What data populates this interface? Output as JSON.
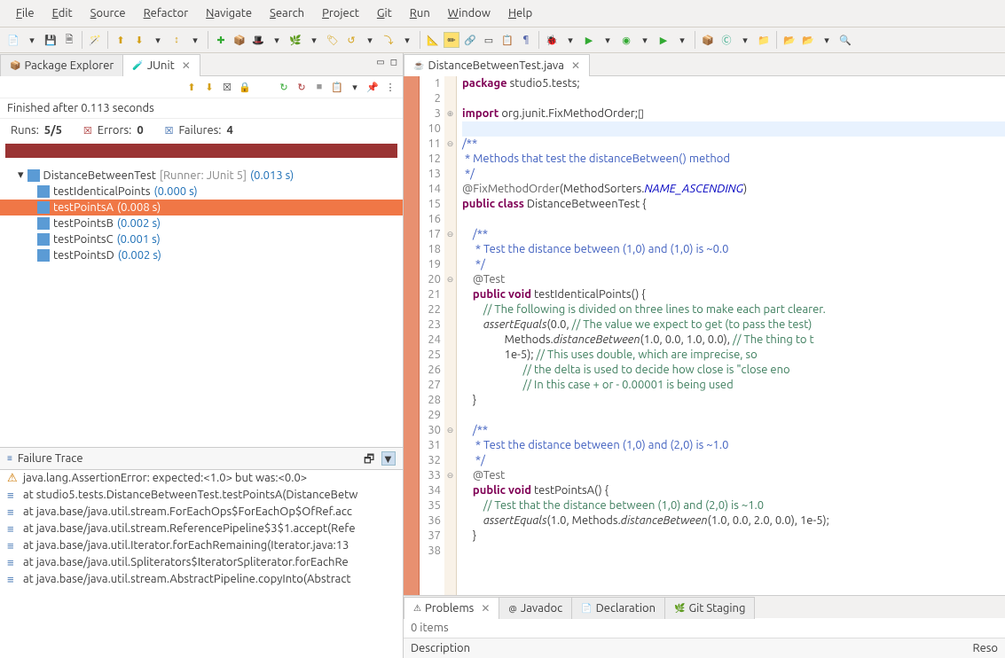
{
  "menu": [
    "File",
    "Edit",
    "Source",
    "Refactor",
    "Navigate",
    "Search",
    "Project",
    "Git",
    "Run",
    "Window",
    "Help"
  ],
  "leftTabs": {
    "pkg": "Package Explorer",
    "junit": "JUnit"
  },
  "junit": {
    "finished": "Finished after 0.113 seconds",
    "runsLabel": "Runs:",
    "runs": "5/5",
    "errorsLabel": "Errors:",
    "errors": "0",
    "failuresLabel": "Failures:",
    "failures": "4"
  },
  "tests": {
    "root": "DistanceBetweenTest",
    "runner": "[Runner: JUnit 5]",
    "rootTime": "(0.013 s)",
    "items": [
      {
        "name": "testIdenticalPoints",
        "time": "(0.000 s)"
      },
      {
        "name": "testPointsA",
        "time": "(0.008 s)",
        "selected": true
      },
      {
        "name": "testPointsB",
        "time": "(0.002 s)"
      },
      {
        "name": "testPointsC",
        "time": "(0.001 s)"
      },
      {
        "name": "testPointsD",
        "time": "(0.002 s)"
      }
    ]
  },
  "traceHeader": "Failure Trace",
  "trace": [
    "java.lang.AssertionError: expected:<1.0> but was:<0.0>",
    "at studio5.tests.DistanceBetweenTest.testPointsA(DistanceBetw",
    "at java.base/java.util.stream.ForEachOps$ForEachOp$OfRef.acc",
    "at java.base/java.util.stream.ReferencePipeline$3$1.accept(Refe",
    "at java.base/java.util.Iterator.forEachRemaining(Iterator.java:13",
    "at java.base/java.util.Spliterators$IteratorSpliterator.forEachRe",
    "at java.base/java.util.stream.AbstractPipeline.copyInto(Abstract"
  ],
  "editorTab": "DistanceBetweenTest.java",
  "code": {
    "lines": [
      {
        "n": 1,
        "h": "<span class='kw'>package</span> studio5.tests;"
      },
      {
        "n": 2,
        "h": ""
      },
      {
        "n": 3,
        "h": "<span class='kw'>import</span> org.junit.FixMethodOrder;▯",
        "fold": "⊕"
      },
      {
        "n": 10,
        "h": "",
        "hl": true
      },
      {
        "n": 11,
        "h": "<span class='doc'>/**</span>",
        "fold": "⊖"
      },
      {
        "n": 12,
        "h": "<span class='doc'> * Methods that test the distanceBetween() method</span>"
      },
      {
        "n": 13,
        "h": "<span class='doc'> */</span>"
      },
      {
        "n": 14,
        "h": "<span class='ann'>@FixMethodOrder</span>(MethodSorters.<span class='fld'>NAME_ASCENDING</span>)"
      },
      {
        "n": 15,
        "h": "<span class='kw'>public</span> <span class='kw'>class</span> DistanceBetweenTest {"
      },
      {
        "n": 16,
        "h": ""
      },
      {
        "n": 17,
        "h": "    <span class='doc'>/**</span>",
        "fold": "⊖"
      },
      {
        "n": 18,
        "h": "    <span class='doc'> * Test the distance between (1,0) and (1,0) is ~0.0</span>"
      },
      {
        "n": 19,
        "h": "    <span class='doc'> */</span>"
      },
      {
        "n": 20,
        "h": "    <span class='ann'>@Test</span>",
        "fold": "⊖"
      },
      {
        "n": 21,
        "h": "    <span class='kw'>public</span> <span class='kw'>void</span> testIdenticalPoints() {"
      },
      {
        "n": 22,
        "h": "        <span class='com'>// The following is divided on three lines to make each part clearer.</span>"
      },
      {
        "n": 23,
        "h": "        <span style='font-style:italic'>assertEquals</span>(0.0, <span class='com'>// The value we expect to get (to pass the test)</span>"
      },
      {
        "n": 24,
        "h": "                Methods.<span style='font-style:italic'>distanceBetween</span>(1.0, 0.0, 1.0, 0.0), <span class='com'>// The thing to t</span>"
      },
      {
        "n": 25,
        "h": "                1e-5); <span class='com'>// This uses double, which are imprecise, so</span>"
      },
      {
        "n": 26,
        "h": "                       <span class='com'>// the delta is used to decide how close is \"close eno</span>"
      },
      {
        "n": 27,
        "h": "                       <span class='com'>// In this case + or - 0.00001 is being used</span>"
      },
      {
        "n": 28,
        "h": "    }"
      },
      {
        "n": 29,
        "h": ""
      },
      {
        "n": 30,
        "h": "    <span class='doc'>/**</span>",
        "fold": "⊖"
      },
      {
        "n": 31,
        "h": "    <span class='doc'> * Test the distance between (1,0) and (2,0) is ~1.0</span>"
      },
      {
        "n": 32,
        "h": "    <span class='doc'> */</span>"
      },
      {
        "n": 33,
        "h": "    <span class='ann'>@Test</span>",
        "fold": "⊖"
      },
      {
        "n": 34,
        "h": "    <span class='kw'>public</span> <span class='kw'>void</span> testPointsA() {"
      },
      {
        "n": 35,
        "h": "        <span class='com'>// Test that the distance between (1,0) and (2,0) is ~1.0</span>"
      },
      {
        "n": 36,
        "h": "        <span style='font-style:italic'>assertEquals</span>(1.0, Methods.<span style='font-style:italic'>distanceBetween</span>(1.0, 0.0, 2.0, 0.0), 1e-5);"
      },
      {
        "n": 37,
        "h": "    }"
      },
      {
        "n": 38,
        "h": ""
      }
    ]
  },
  "bottomTabs": [
    "Problems",
    "Javadoc",
    "Declaration",
    "Git Staging"
  ],
  "problems": {
    "count": "0 items",
    "col1": "Description",
    "col2": "Reso"
  }
}
